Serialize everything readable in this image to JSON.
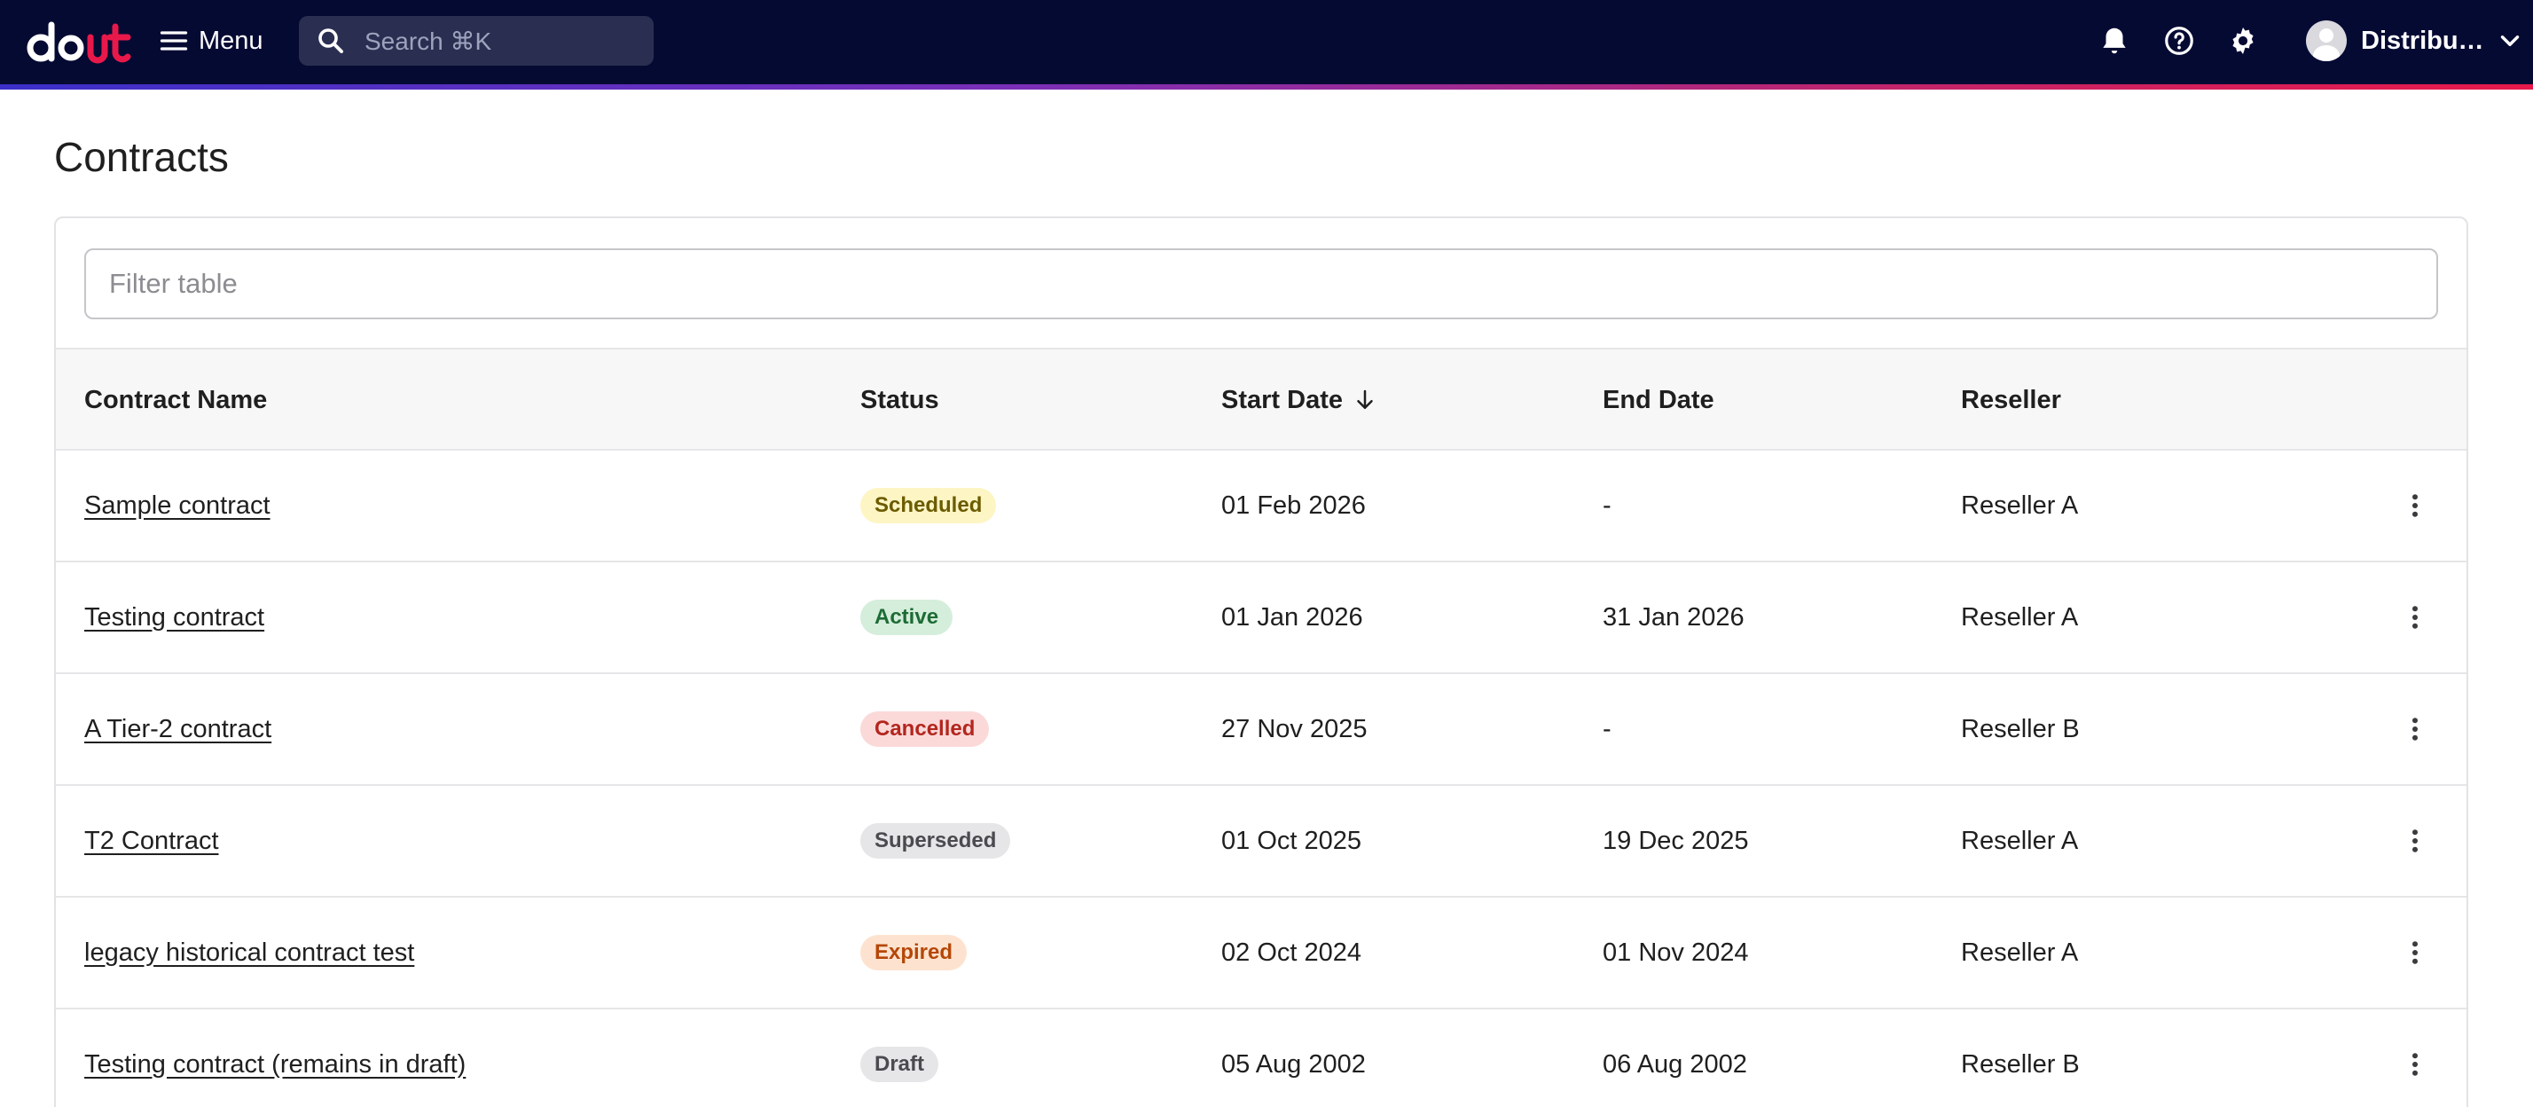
{
  "header": {
    "menu_label": "Menu",
    "search_placeholder": "Search ⌘K",
    "user_label": "Distribu…",
    "icons": [
      "menu-icon",
      "search-icon",
      "bell-icon",
      "help-icon",
      "gear-icon",
      "avatar",
      "chevron-down-icon"
    ],
    "colors": {
      "bar": "#050a33",
      "accent_start": "#3b2fc9",
      "accent_end": "#e8194a"
    }
  },
  "page": {
    "title": "Contracts"
  },
  "filter": {
    "placeholder": "Filter table"
  },
  "table": {
    "columns": [
      {
        "label": "Contract Name"
      },
      {
        "label": "Status"
      },
      {
        "label": "Start Date",
        "sort": "descending"
      },
      {
        "label": "End Date"
      },
      {
        "label": "Reseller"
      }
    ],
    "rows": [
      {
        "name": "Sample contract",
        "status": "Scheduled",
        "start": "01 Feb 2026",
        "end": "-",
        "reseller": "Reseller A"
      },
      {
        "name": "Testing contract",
        "status": "Active",
        "start": "01 Jan 2026",
        "end": "31 Jan 2026",
        "reseller": "Reseller A"
      },
      {
        "name": "A Tier-2 contract",
        "status": "Cancelled",
        "start": "27 Nov 2025",
        "end": "-",
        "reseller": "Reseller B"
      },
      {
        "name": "T2 Contract",
        "status": "Superseded",
        "start": "01 Oct 2025",
        "end": "19 Dec 2025",
        "reseller": "Reseller A"
      },
      {
        "name": "legacy historical contract test",
        "status": "Expired",
        "start": "02 Oct 2024",
        "end": "01 Nov 2024",
        "reseller": "Reseller A"
      },
      {
        "name": "Testing contract (remains in draft)",
        "status": "Draft",
        "start": "05 Aug 2002",
        "end": "06 Aug 2002",
        "reseller": "Reseller B"
      }
    ]
  },
  "status_colors": {
    "Scheduled": {
      "bg": "#fdf5c4",
      "fg": "#6b5b00"
    },
    "Active": {
      "bg": "#d4eedb",
      "fg": "#1e6b35"
    },
    "Cancelled": {
      "bg": "#fbd9d9",
      "fg": "#b3261e"
    },
    "Superseded": {
      "bg": "#e6e6e8",
      "fg": "#4a4a4f"
    },
    "Expired": {
      "bg": "#fde3cf",
      "fg": "#b54708"
    },
    "Draft": {
      "bg": "#e6e6e8",
      "fg": "#4a4a4f"
    }
  }
}
